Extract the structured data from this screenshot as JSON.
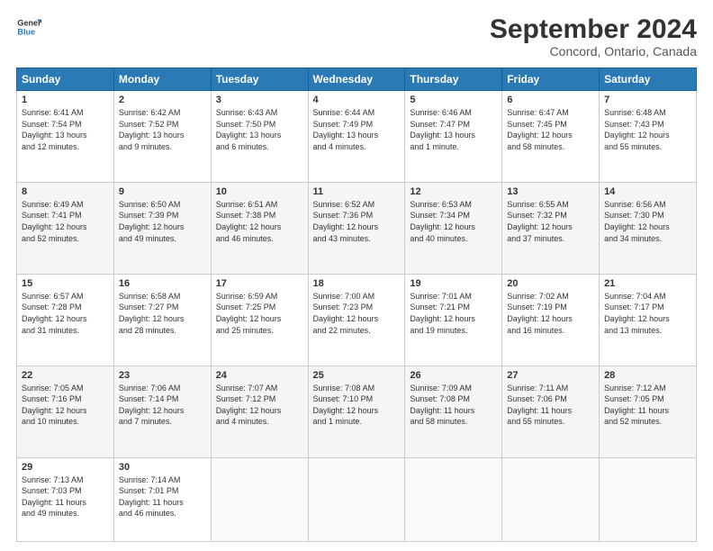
{
  "header": {
    "logo_line1": "General",
    "logo_line2": "Blue",
    "month_title": "September 2024",
    "subtitle": "Concord, Ontario, Canada"
  },
  "days_of_week": [
    "Sunday",
    "Monday",
    "Tuesday",
    "Wednesday",
    "Thursday",
    "Friday",
    "Saturday"
  ],
  "weeks": [
    [
      {
        "day": "1",
        "info": "Sunrise: 6:41 AM\nSunset: 7:54 PM\nDaylight: 13 hours\nand 12 minutes."
      },
      {
        "day": "2",
        "info": "Sunrise: 6:42 AM\nSunset: 7:52 PM\nDaylight: 13 hours\nand 9 minutes."
      },
      {
        "day": "3",
        "info": "Sunrise: 6:43 AM\nSunset: 7:50 PM\nDaylight: 13 hours\nand 6 minutes."
      },
      {
        "day": "4",
        "info": "Sunrise: 6:44 AM\nSunset: 7:49 PM\nDaylight: 13 hours\nand 4 minutes."
      },
      {
        "day": "5",
        "info": "Sunrise: 6:46 AM\nSunset: 7:47 PM\nDaylight: 13 hours\nand 1 minute."
      },
      {
        "day": "6",
        "info": "Sunrise: 6:47 AM\nSunset: 7:45 PM\nDaylight: 12 hours\nand 58 minutes."
      },
      {
        "day": "7",
        "info": "Sunrise: 6:48 AM\nSunset: 7:43 PM\nDaylight: 12 hours\nand 55 minutes."
      }
    ],
    [
      {
        "day": "8",
        "info": "Sunrise: 6:49 AM\nSunset: 7:41 PM\nDaylight: 12 hours\nand 52 minutes."
      },
      {
        "day": "9",
        "info": "Sunrise: 6:50 AM\nSunset: 7:39 PM\nDaylight: 12 hours\nand 49 minutes."
      },
      {
        "day": "10",
        "info": "Sunrise: 6:51 AM\nSunset: 7:38 PM\nDaylight: 12 hours\nand 46 minutes."
      },
      {
        "day": "11",
        "info": "Sunrise: 6:52 AM\nSunset: 7:36 PM\nDaylight: 12 hours\nand 43 minutes."
      },
      {
        "day": "12",
        "info": "Sunrise: 6:53 AM\nSunset: 7:34 PM\nDaylight: 12 hours\nand 40 minutes."
      },
      {
        "day": "13",
        "info": "Sunrise: 6:55 AM\nSunset: 7:32 PM\nDaylight: 12 hours\nand 37 minutes."
      },
      {
        "day": "14",
        "info": "Sunrise: 6:56 AM\nSunset: 7:30 PM\nDaylight: 12 hours\nand 34 minutes."
      }
    ],
    [
      {
        "day": "15",
        "info": "Sunrise: 6:57 AM\nSunset: 7:28 PM\nDaylight: 12 hours\nand 31 minutes."
      },
      {
        "day": "16",
        "info": "Sunrise: 6:58 AM\nSunset: 7:27 PM\nDaylight: 12 hours\nand 28 minutes."
      },
      {
        "day": "17",
        "info": "Sunrise: 6:59 AM\nSunset: 7:25 PM\nDaylight: 12 hours\nand 25 minutes."
      },
      {
        "day": "18",
        "info": "Sunrise: 7:00 AM\nSunset: 7:23 PM\nDaylight: 12 hours\nand 22 minutes."
      },
      {
        "day": "19",
        "info": "Sunrise: 7:01 AM\nSunset: 7:21 PM\nDaylight: 12 hours\nand 19 minutes."
      },
      {
        "day": "20",
        "info": "Sunrise: 7:02 AM\nSunset: 7:19 PM\nDaylight: 12 hours\nand 16 minutes."
      },
      {
        "day": "21",
        "info": "Sunrise: 7:04 AM\nSunset: 7:17 PM\nDaylight: 12 hours\nand 13 minutes."
      }
    ],
    [
      {
        "day": "22",
        "info": "Sunrise: 7:05 AM\nSunset: 7:16 PM\nDaylight: 12 hours\nand 10 minutes."
      },
      {
        "day": "23",
        "info": "Sunrise: 7:06 AM\nSunset: 7:14 PM\nDaylight: 12 hours\nand 7 minutes."
      },
      {
        "day": "24",
        "info": "Sunrise: 7:07 AM\nSunset: 7:12 PM\nDaylight: 12 hours\nand 4 minutes."
      },
      {
        "day": "25",
        "info": "Sunrise: 7:08 AM\nSunset: 7:10 PM\nDaylight: 12 hours\nand 1 minute."
      },
      {
        "day": "26",
        "info": "Sunrise: 7:09 AM\nSunset: 7:08 PM\nDaylight: 11 hours\nand 58 minutes."
      },
      {
        "day": "27",
        "info": "Sunrise: 7:11 AM\nSunset: 7:06 PM\nDaylight: 11 hours\nand 55 minutes."
      },
      {
        "day": "28",
        "info": "Sunrise: 7:12 AM\nSunset: 7:05 PM\nDaylight: 11 hours\nand 52 minutes."
      }
    ],
    [
      {
        "day": "29",
        "info": "Sunrise: 7:13 AM\nSunset: 7:03 PM\nDaylight: 11 hours\nand 49 minutes."
      },
      {
        "day": "30",
        "info": "Sunrise: 7:14 AM\nSunset: 7:01 PM\nDaylight: 11 hours\nand 46 minutes."
      },
      {
        "day": "",
        "info": ""
      },
      {
        "day": "",
        "info": ""
      },
      {
        "day": "",
        "info": ""
      },
      {
        "day": "",
        "info": ""
      },
      {
        "day": "",
        "info": ""
      }
    ]
  ]
}
